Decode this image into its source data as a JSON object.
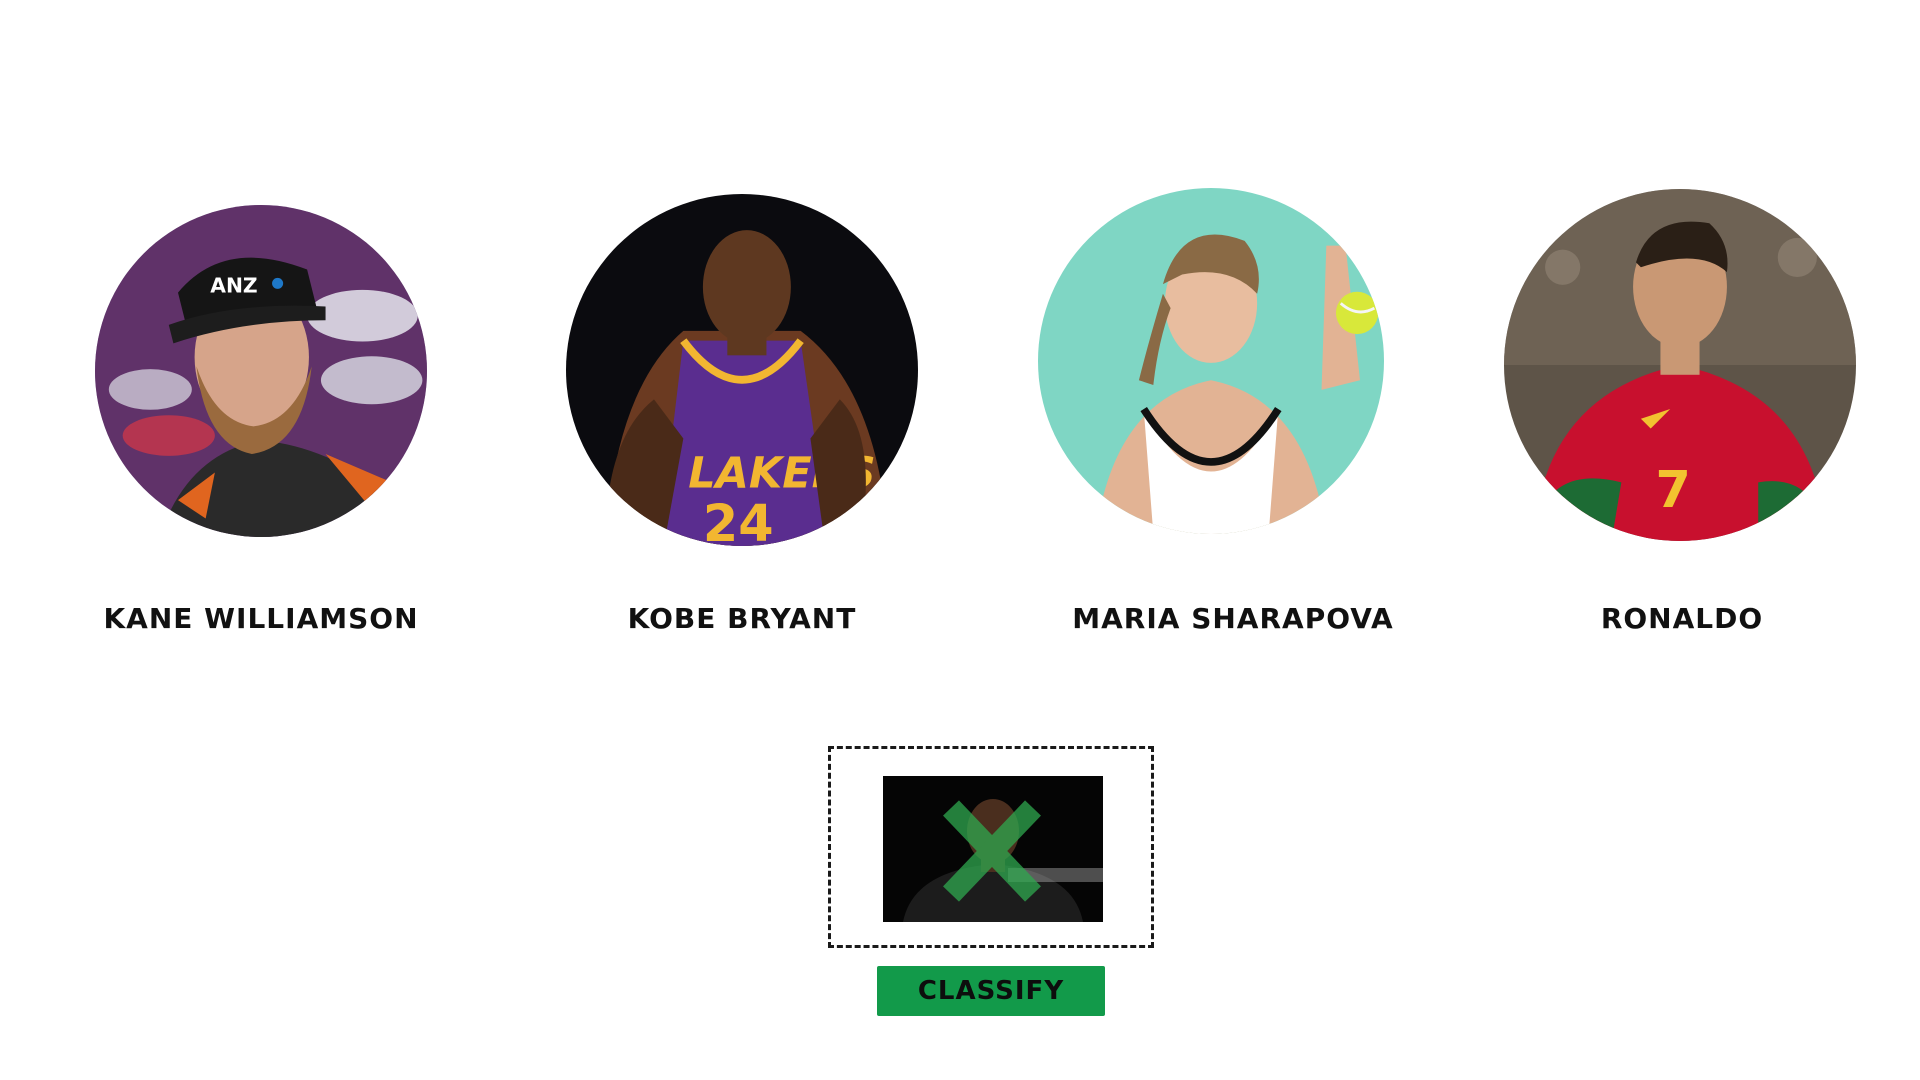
{
  "athletes": [
    {
      "name": "Kane Williamson",
      "avatar_icon": "kane-williamson-photo"
    },
    {
      "name": "Kobe Bryant",
      "avatar_icon": "kobe-bryant-photo"
    },
    {
      "name": "Maria Sharapova",
      "avatar_icon": "maria-sharapova-photo"
    },
    {
      "name": "Ronaldo",
      "avatar_icon": "ronaldo-photo"
    }
  ],
  "dropzone": {
    "preview_icon": "uploaded-image-preview",
    "overlay_icon": "close-x-icon"
  },
  "classify_button": {
    "label": "CLASSIFY"
  },
  "colors": {
    "button_bg": "#129a4a",
    "overlay_x": "#2fa84f",
    "text": "#111111"
  }
}
